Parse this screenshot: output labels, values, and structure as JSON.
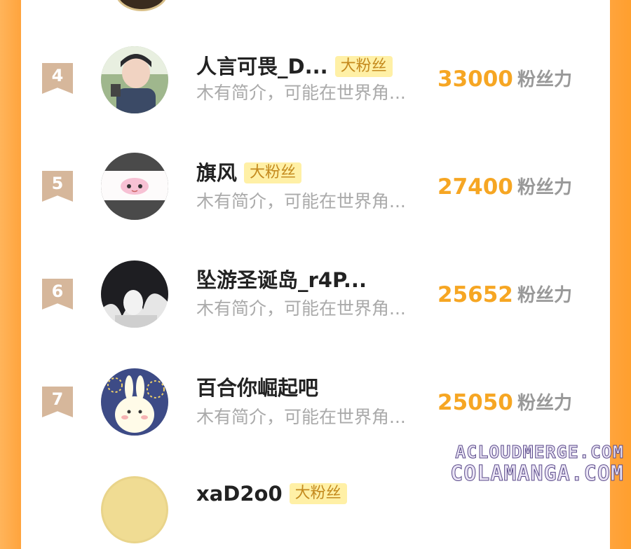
{
  "rows": [
    {
      "rank": "4",
      "name": "人言可畏_D...",
      "badge": "大粉丝",
      "intro": "木有简介，可能在世界角...",
      "score": "33000",
      "unit": "粉丝力"
    },
    {
      "rank": "5",
      "name": "旗风",
      "badge": "大粉丝",
      "intro": "木有简介，可能在世界角...",
      "score": "27400",
      "unit": "粉丝力"
    },
    {
      "rank": "6",
      "name": "坠游圣诞岛_r4P...",
      "badge": "",
      "intro": "木有简介，可能在世界角...",
      "score": "25652",
      "unit": "粉丝力"
    },
    {
      "rank": "7",
      "name": "百合你崛起吧",
      "badge": "",
      "intro": "木有简介，可能在世界角...",
      "score": "25050",
      "unit": "粉丝力"
    },
    {
      "rank": "",
      "name": "xaD2o0",
      "badge": "大粉丝",
      "intro": "",
      "score": "",
      "unit": ""
    }
  ],
  "watermark": {
    "line1": "ACLOUDMERGE.COM",
    "line2": "COLAMANGA.COM"
  },
  "colors": {
    "accent": "#f6a623",
    "frame": "#ffa43d",
    "rank_badge": "#d6b79b",
    "fan_badge_bg": "#fff0a6"
  }
}
